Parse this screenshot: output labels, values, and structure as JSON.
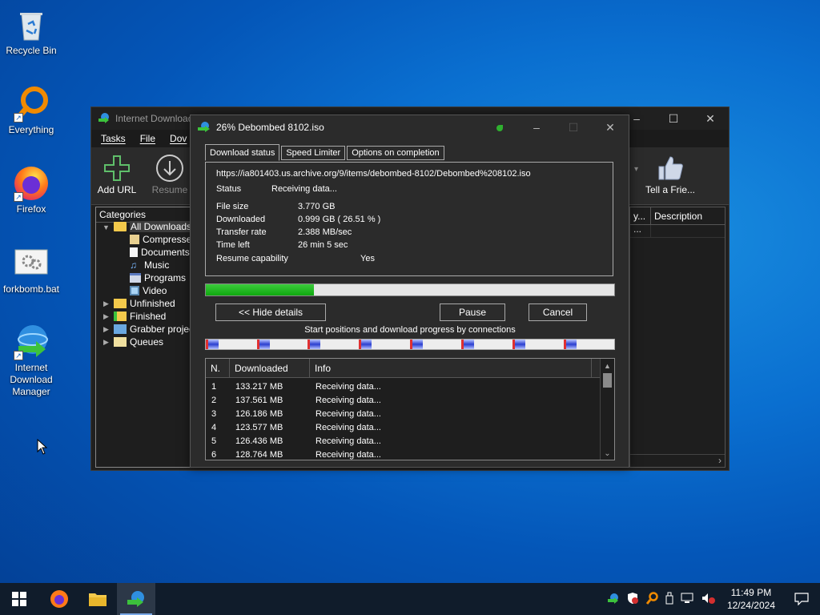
{
  "desktop": {
    "icons": [
      {
        "label": "Recycle Bin",
        "icon": "recycle-bin-icon"
      },
      {
        "label": "Everything",
        "icon": "everything-search-icon"
      },
      {
        "label": "Firefox",
        "icon": "firefox-icon"
      },
      {
        "label": "forkbomb.bat",
        "icon": "batch-file-icon"
      },
      {
        "label": "Internet Download Manager",
        "icon": "idm-icon"
      }
    ]
  },
  "main_window": {
    "title": "Internet Download",
    "menu": [
      "Tasks",
      "File",
      "Dov"
    ],
    "toolbar": {
      "add_url": "Add URL",
      "resume": "Resume",
      "tell_friend": "Tell a Frie..."
    },
    "categories_header": "Categories",
    "tree": {
      "all_downloads": "All Downloads",
      "compressed": "Compresse",
      "documents": "Documents",
      "music": "Music",
      "programs": "Programs",
      "video": "Video",
      "unfinished": "Unfinished",
      "finished": "Finished",
      "grabber": "Grabber projec",
      "queues": "Queues"
    },
    "list_columns": {
      "col1": "y...",
      "description": "Description"
    },
    "list_cell": "..."
  },
  "dialog": {
    "title": "26% Debombed 8102.iso",
    "tabs": [
      "Download status",
      "Speed Limiter",
      "Options on completion"
    ],
    "url": "https://ia801403.us.archive.org/9/items/debombed-8102/Debombed%208102.iso",
    "status_label": "Status",
    "status_value": "Receiving data...",
    "file_size_label": "File size",
    "file_size_value": "3.770  GB",
    "downloaded_label": "Downloaded",
    "downloaded_value": "0.999  GB  ( 26.51 % )",
    "transfer_rate_label": "Transfer rate",
    "transfer_rate_value": "2.388  MB/sec",
    "time_left_label": "Time left",
    "time_left_value": "26 min 5 sec",
    "resume_label": "Resume capability",
    "resume_value": "Yes",
    "progress": 0.2651,
    "buttons": {
      "hide_details": "<< Hide details",
      "pause": "Pause",
      "cancel": "Cancel"
    },
    "connections_caption": "Start positions and download progress by connections",
    "connections_table": {
      "columns": [
        "N.",
        "Downloaded",
        "Info"
      ],
      "rows": [
        [
          "1",
          "133.217  MB",
          "Receiving data..."
        ],
        [
          "2",
          "137.561  MB",
          "Receiving data..."
        ],
        [
          "3",
          "126.186  MB",
          "Receiving data..."
        ],
        [
          "4",
          "123.577  MB",
          "Receiving data..."
        ],
        [
          "5",
          "126.436  MB",
          "Receiving data..."
        ],
        [
          "6",
          "128.764  MB",
          "Receiving data..."
        ]
      ]
    }
  },
  "taskbar": {
    "time": "11:49 PM",
    "date": "12/24/2024"
  },
  "colors": {
    "progress_green": "#0fa80f",
    "desktop_blue": "#0a6fd0"
  }
}
